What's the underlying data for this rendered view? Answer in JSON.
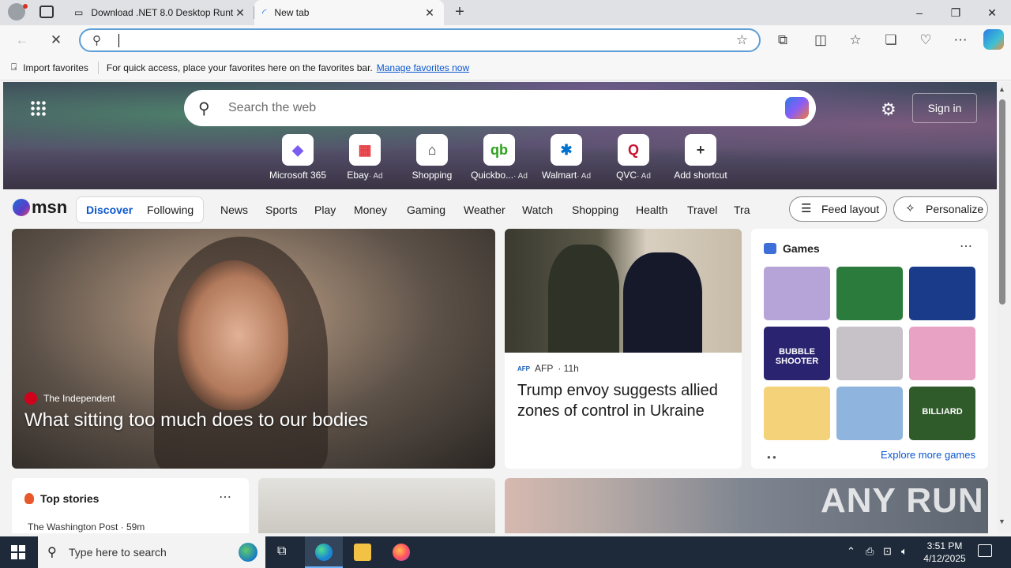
{
  "browser": {
    "tabs": [
      {
        "title": "Download .NET 8.0 Desktop Runt",
        "active": false
      },
      {
        "title": "New tab",
        "active": true
      }
    ],
    "new_tab_glyph": "+",
    "window_controls": [
      "–",
      "❐",
      "✕"
    ],
    "address_value": "",
    "favorites_bar": {
      "import_label": "Import favorites",
      "hint": "For quick access, place your favorites here on the favorites bar.",
      "manage_link": "Manage favorites now"
    }
  },
  "newtab": {
    "search_placeholder": "Search the web",
    "sign_in": "Sign in",
    "shortcuts": [
      {
        "label": "Microsoft 365",
        "ad": "",
        "icon": "microsoft365-icon",
        "glyph": "◆",
        "color": "#7a5cf0"
      },
      {
        "label": "Ebay",
        "ad": "· Ad",
        "icon": "ebay-bag-icon",
        "glyph": "▦",
        "color": "#e53238"
      },
      {
        "label": "Shopping",
        "ad": "",
        "icon": "tag-icon",
        "glyph": "⌂",
        "color": "#333333"
      },
      {
        "label": "Quickbo...",
        "ad": "· Ad",
        "icon": "quickbooks-icon",
        "glyph": "qb",
        "color": "#2ca01c"
      },
      {
        "label": "Walmart",
        "ad": "· Ad",
        "icon": "walmart-icon",
        "glyph": "✱",
        "color": "#0071ce"
      },
      {
        "label": "QVC",
        "ad": "· Ad",
        "icon": "qvc-icon",
        "glyph": "Q",
        "color": "#c8102e"
      },
      {
        "label": "Add shortcut",
        "ad": "",
        "icon": "plus-icon",
        "glyph": "+",
        "color": "#333333"
      }
    ],
    "msn_logo": "msn",
    "feed_tabs": [
      "Discover",
      "Following"
    ],
    "nav_items": [
      "News",
      "Sports",
      "Play",
      "Money",
      "Gaming",
      "Weather",
      "Watch",
      "Shopping",
      "Health",
      "Travel",
      "Tra"
    ],
    "feed_layout": "Feed layout",
    "personalize": "Personalize",
    "lead_story": {
      "source": "The Independent",
      "headline": "What sitting too much does to our bodies"
    },
    "story2": {
      "source_logo": "AFP",
      "source": "AFP",
      "age": "· 11h",
      "headline": "Trump envoy suggests allied zones of control in Ukraine"
    },
    "games": {
      "title": "Games",
      "explore": "Explore more games",
      "tiles": [
        {
          "name": "makeup-game",
          "color": "#b6a4d8"
        },
        {
          "name": "jewel-match-game",
          "color": "#2b7c3c"
        },
        {
          "name": "block-puzzle-game",
          "color": "#1a3a8a"
        },
        {
          "name": "bubble-shooter-game",
          "color": "#2a2470"
        },
        {
          "name": "hospital-game",
          "color": "#c7c1c8"
        },
        {
          "name": "dress-up-game",
          "color": "#e8a2c4"
        },
        {
          "name": "shiba-game",
          "color": "#f3d27a"
        },
        {
          "name": "thief-puzzle-game",
          "color": "#8fb5de"
        },
        {
          "name": "8ball-billiard-game",
          "color": "#2f5a2a"
        }
      ],
      "bubble_shooter_label": "BUBBLE SHOOTER",
      "billiard_label": "BILLIARD"
    },
    "top_stories": {
      "title": "Top stories",
      "first_source": "The Washington Post · 59m"
    },
    "watermark": "ANY RUN"
  },
  "taskbar": {
    "search_placeholder": "Type here to search",
    "time": "3:51 PM",
    "date": "4/12/2025"
  },
  "colors": {
    "accent": "#0b57d0",
    "taskbar": "#1e2a3a"
  }
}
